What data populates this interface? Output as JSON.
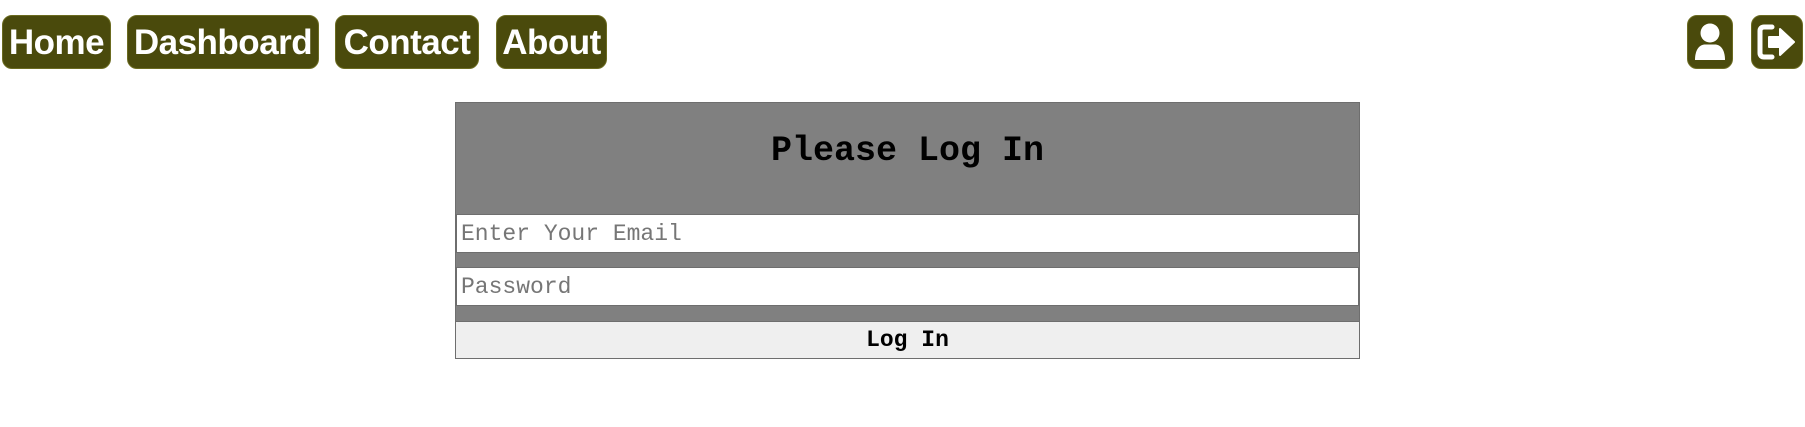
{
  "nav": {
    "home_label": "Home",
    "dashboard_label": "Dashboard",
    "contact_label": "Contact",
    "about_label": "About"
  },
  "actions": {
    "profile_icon": "user-icon",
    "logout_icon": "sign-out-icon"
  },
  "login": {
    "title": "Please Log In",
    "email_placeholder": "Enter Your Email",
    "email_value": "",
    "password_placeholder": "Password",
    "password_value": "",
    "submit_label": "Log In"
  },
  "colors": {
    "nav_bg": "#4a4a0c",
    "nav_text": "#ffffff",
    "card_bg": "#808080",
    "button_bg": "#efefef"
  }
}
